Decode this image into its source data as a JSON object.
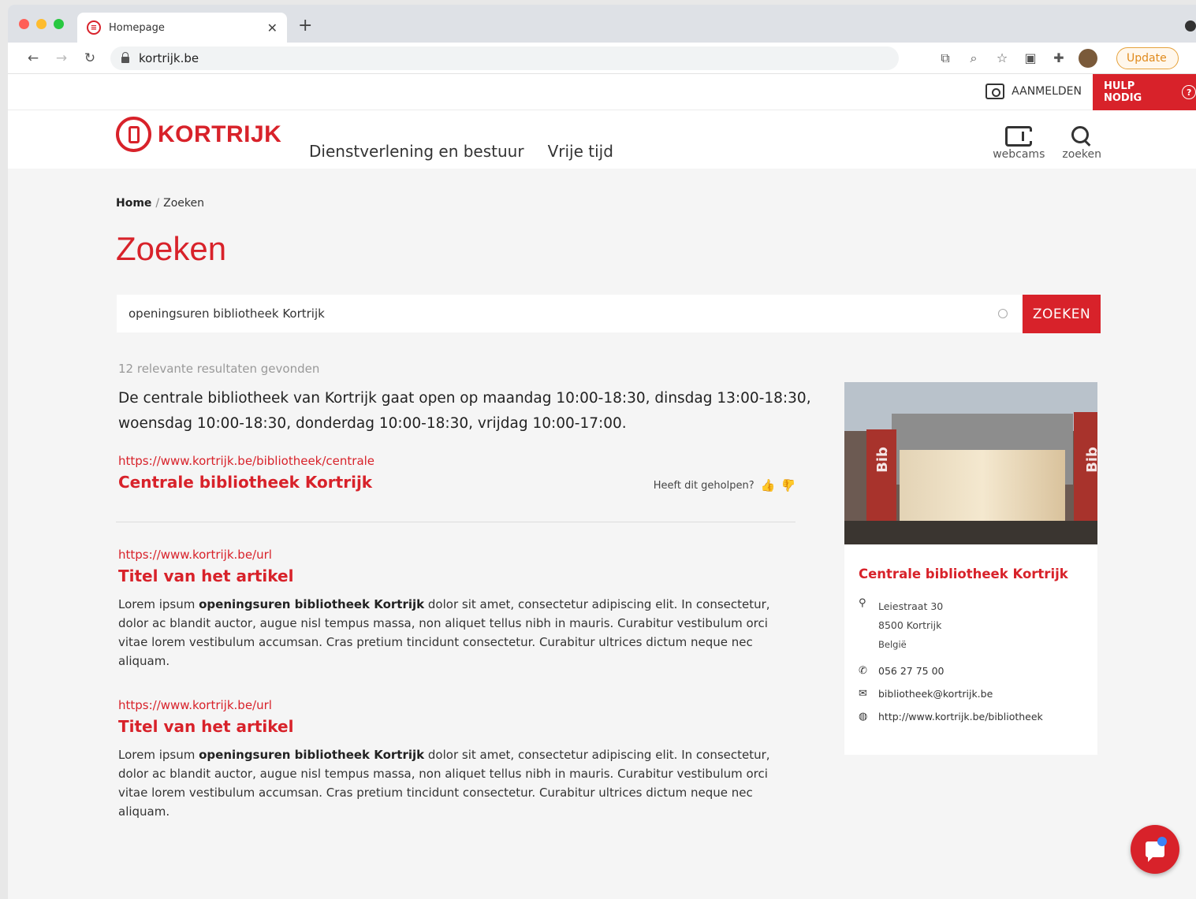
{
  "browser": {
    "tab_title": "Homepage",
    "url": "kortrijk.be",
    "update_label": "Update"
  },
  "utility": {
    "login_label": "AANMELDEN",
    "help_label": "HULP NODIG",
    "help_icon": "?"
  },
  "header": {
    "logo_text": "KORTRIJK",
    "nav": [
      "Dienstverlening en bestuur",
      "Vrije tijd"
    ],
    "webcams_label": "webcams",
    "search_label": "zoeken"
  },
  "breadcrumb": {
    "home": "Home",
    "separator": "/",
    "current": "Zoeken"
  },
  "page_title": "Zoeken",
  "search": {
    "value": "openingsuren bibliotheek Kortrijk",
    "button_label": "ZOEKEN"
  },
  "results": {
    "count_text": "12 relevante resultaten gevonden",
    "answer": "De centrale bibliotheek van Kortrijk gaat open op maandag 10:00-18:30, dinsdag 13:00-18:30, woensdag 10:00-18:30, donderdag 10:00-18:30, vrijdag 10:00-17:00.",
    "featured": {
      "url": "https://www.kortrijk.be/bibliotheek/centrale",
      "title": "Centrale bibliotheek Kortrijk",
      "feedback_question": "Heeft dit geholpen?"
    },
    "items": [
      {
        "url": "https://www.kortrijk.be/url",
        "title": "Titel van het artikel",
        "snippet_pre": "Lorem ipsum ",
        "snippet_bold": "openingsuren bibliotheek Kortrijk",
        "snippet_post": " dolor sit amet, consectetur adipiscing elit. In consectetur, dolor ac blandit auctor, augue nisl tempus massa, non aliquet tellus nibh in mauris. Curabitur vestibulum orci vitae lorem vestibulum accumsan. Cras pretium tincidunt consectetur. Curabitur ultrices dictum neque nec aliquam."
      },
      {
        "url": "https://www.kortrijk.be/url",
        "title": "Titel van het artikel",
        "snippet_pre": "Lorem ipsum ",
        "snippet_bold": "openingsuren bibliotheek Kortrijk",
        "snippet_post": " dolor sit amet, consectetur adipiscing elit. In consectetur, dolor ac blandit auctor, augue nisl tempus massa, non aliquet tellus nibh in mauris. Curabitur vestibulum orci vitae lorem vestibulum accumsan. Cras pretium tincidunt consectetur. Curabitur ultrices dictum neque nec aliquam."
      }
    ]
  },
  "card": {
    "photo_sign_left": "Bib",
    "photo_sign_right": "Bib",
    "title": "Centrale bibliotheek Kortrijk",
    "street": "Leiestraat 30",
    "city": "8500 Kortrijk",
    "country": "België",
    "phone": "056 27 75 00",
    "email": "bibliotheek@kortrijk.be",
    "website": "http://www.kortrijk.be/bibliotheek"
  },
  "colors": {
    "brand": "#d8222a",
    "thumb_up": "#6cbb2c"
  }
}
